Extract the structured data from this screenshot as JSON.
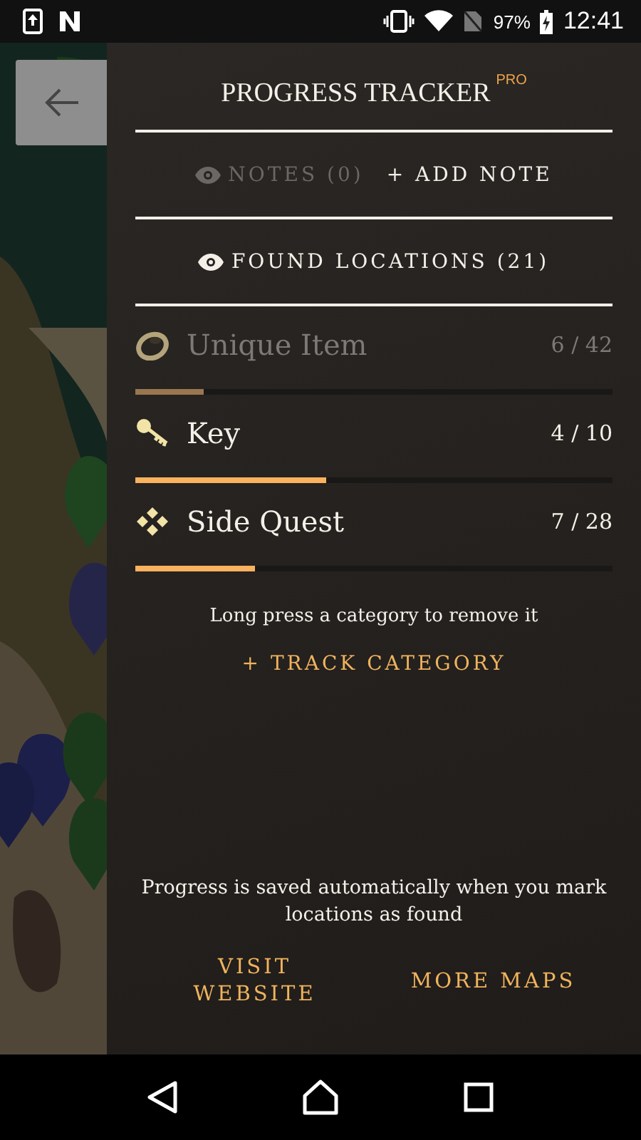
{
  "status_bar": {
    "battery": "97%",
    "time": "12:41"
  },
  "panel": {
    "title": "PROGRESS TRACKER",
    "badge": "PRO",
    "notes": {
      "label": "NOTES (0)",
      "disabled": true
    },
    "add_note": "+ ADD NOTE",
    "found": {
      "label": "FOUND LOCATIONS (21)"
    },
    "categories": [
      {
        "kind": "ring",
        "name": "Unique Item",
        "count": "6 / 42",
        "level": 0.143,
        "dimmed": true
      },
      {
        "kind": "key",
        "name": "Key",
        "count": "4 / 10",
        "level": 0.4,
        "dimmed": false
      },
      {
        "kind": "quest",
        "name": "Side Quest",
        "count": "7 / 28",
        "level": 0.25,
        "dimmed": false
      }
    ],
    "hint": "Long press a category to remove it",
    "track": "+ TRACK CATEGORY",
    "footer_note": "Progress is saved automatically when you mark locations as found",
    "links": [
      "VISIT WEBSITE",
      "MORE MAPS"
    ]
  }
}
